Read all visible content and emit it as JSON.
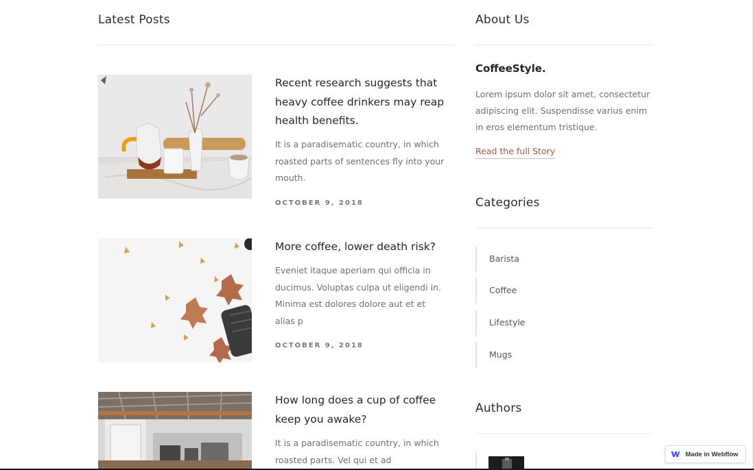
{
  "latest_posts": {
    "heading": "Latest Posts",
    "posts": [
      {
        "title": "Recent research suggests that heavy coffee drinkers may reap health benefits.",
        "excerpt": "It is a paradisematic country, in which roasted parts of sentences fly into your mouth.",
        "date": "OCTOBER 9, 2018"
      },
      {
        "title": "More coffee, lower death risk?",
        "excerpt": "Eveniet itaque aperiam qui officia in ducimus. Voluptas culpa ut eligendi in. Minima est dolores dolore aut et et alias p",
        "date": "OCTOBER 9, 2018"
      },
      {
        "title": "How long does a cup of coffee keep you awake?",
        "excerpt": "It is a paradisematic country, in which roasted parts. Vel qui et ad"
      }
    ]
  },
  "about": {
    "heading": "About Us",
    "brand": "CoffeeStyle.",
    "text": "Lorem ipsum dolor sit amet, consectetur adipiscing elit. Suspendisse varius enim in eros elementum tristique.",
    "link_label": "Read the full Story"
  },
  "categories": {
    "heading": "Categories",
    "items": [
      "Barista",
      "Coffee",
      "Lifestyle",
      "Mugs"
    ]
  },
  "authors": {
    "heading": "Authors"
  },
  "badge": {
    "label": "Made in Webflow"
  },
  "colors": {
    "accent_link": "#a35b3d",
    "webflow_blue": "#4353ff"
  }
}
